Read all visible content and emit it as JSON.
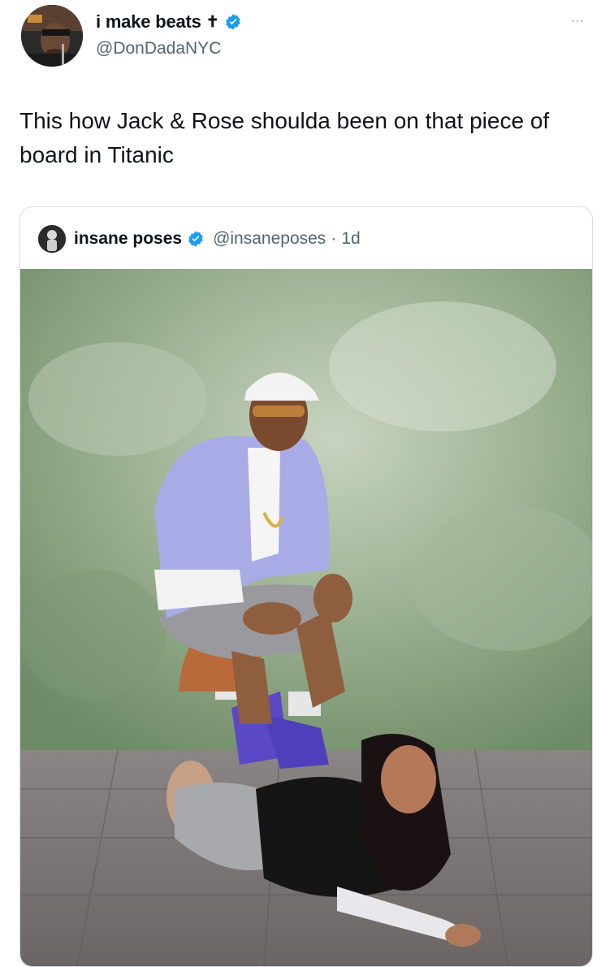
{
  "author": {
    "display_name": "i make beats",
    "emoji_icon": "cross-icon",
    "emoji_glyph": "✝",
    "handle": "@DonDadaNYC",
    "verified_color": "#1d9bf0"
  },
  "more_menu": {
    "icon": "more-icon",
    "glyph": "···"
  },
  "tweet": {
    "text": "This how Jack & Rose shoulda been on that piece of board in Titanic"
  },
  "quoted": {
    "display_name": "insane poses",
    "handle": "@insaneposes",
    "separator": "·",
    "time": "1d",
    "verified_color": "#1d9bf0"
  },
  "photo": {
    "background_color": "#8fa889",
    "floor_color": "#7a7676"
  }
}
